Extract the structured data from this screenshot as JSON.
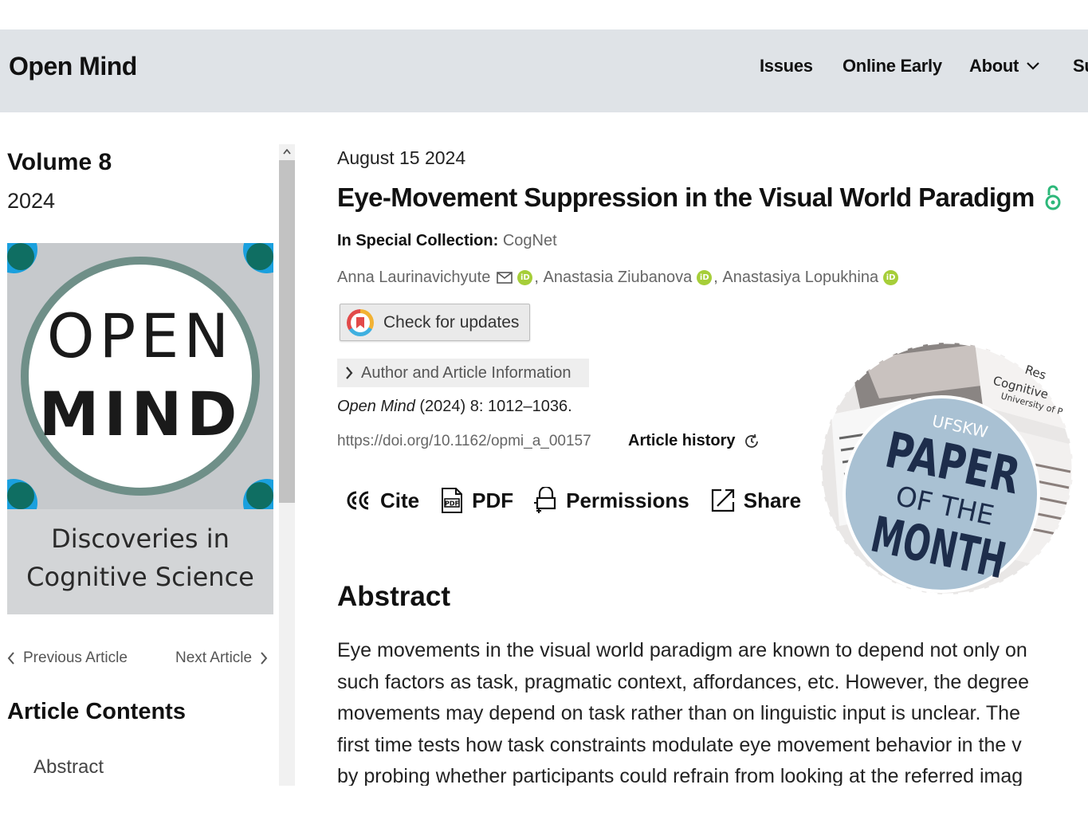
{
  "header": {
    "brand": "Open Mind",
    "nav": {
      "issues": "Issues",
      "online_early": "Online Early",
      "about": "About",
      "sub_partial": "Su"
    }
  },
  "sidebar": {
    "volume": "Volume 8",
    "year": "2024",
    "cover": {
      "line1": "OPEN",
      "line2": "MIND",
      "subtitle1": "Discoveries in",
      "subtitle2": "Cognitive Science"
    },
    "prev_label": "Previous Article",
    "next_label": "Next Article",
    "contents_title": "Article Contents",
    "contents_items": [
      "Abstract"
    ]
  },
  "article": {
    "date": "August 15 2024",
    "title": "Eye-Movement Suppression in the Visual World Paradigm",
    "special_label": "In Special Collection:",
    "special_value": "CogNet",
    "authors": [
      "Anna Laurinavichyute",
      "Anastasia Ziubanova",
      "Anastasiya Lopukhina"
    ],
    "author_sep": ", ",
    "orcid_label": "iD",
    "check_updates": "Check for updates",
    "author_info": "Author and Article Information",
    "citation_journal": "Open Mind",
    "citation_rest": " (2024) 8: 1012–1036.",
    "doi": "https://doi.org/10.1162/opmi_a_00157",
    "history": "Article history",
    "tools": {
      "cite": "Cite",
      "pdf": "PDF",
      "permissions": "Permissions",
      "share": "Share"
    },
    "abstract_heading": "Abstract",
    "abstract_lines": [
      "Eye movements in the visual world paradigm are known to depend not only on",
      "such factors as task, pragmatic context, affordances, etc. However, the degree",
      "movements may depend on task rather than on linguistic input is unclear. The",
      "first time tests how task constraints modulate eye movement behavior in the v",
      "by probing whether participants could refrain from looking at the referred imag"
    ]
  },
  "badge": {
    "top_text1": "Res",
    "top_text2": "Cognitive",
    "top_text3": "University of P",
    "org": "UFSKW",
    "line1": "PAPER",
    "line2": "OF THE",
    "line3": "MONTH"
  },
  "colors": {
    "header_bg": "#dfe3e7",
    "open_access": "#2db87a",
    "orcid": "#a6ce39",
    "badge_blue": "#a9c1d3"
  }
}
